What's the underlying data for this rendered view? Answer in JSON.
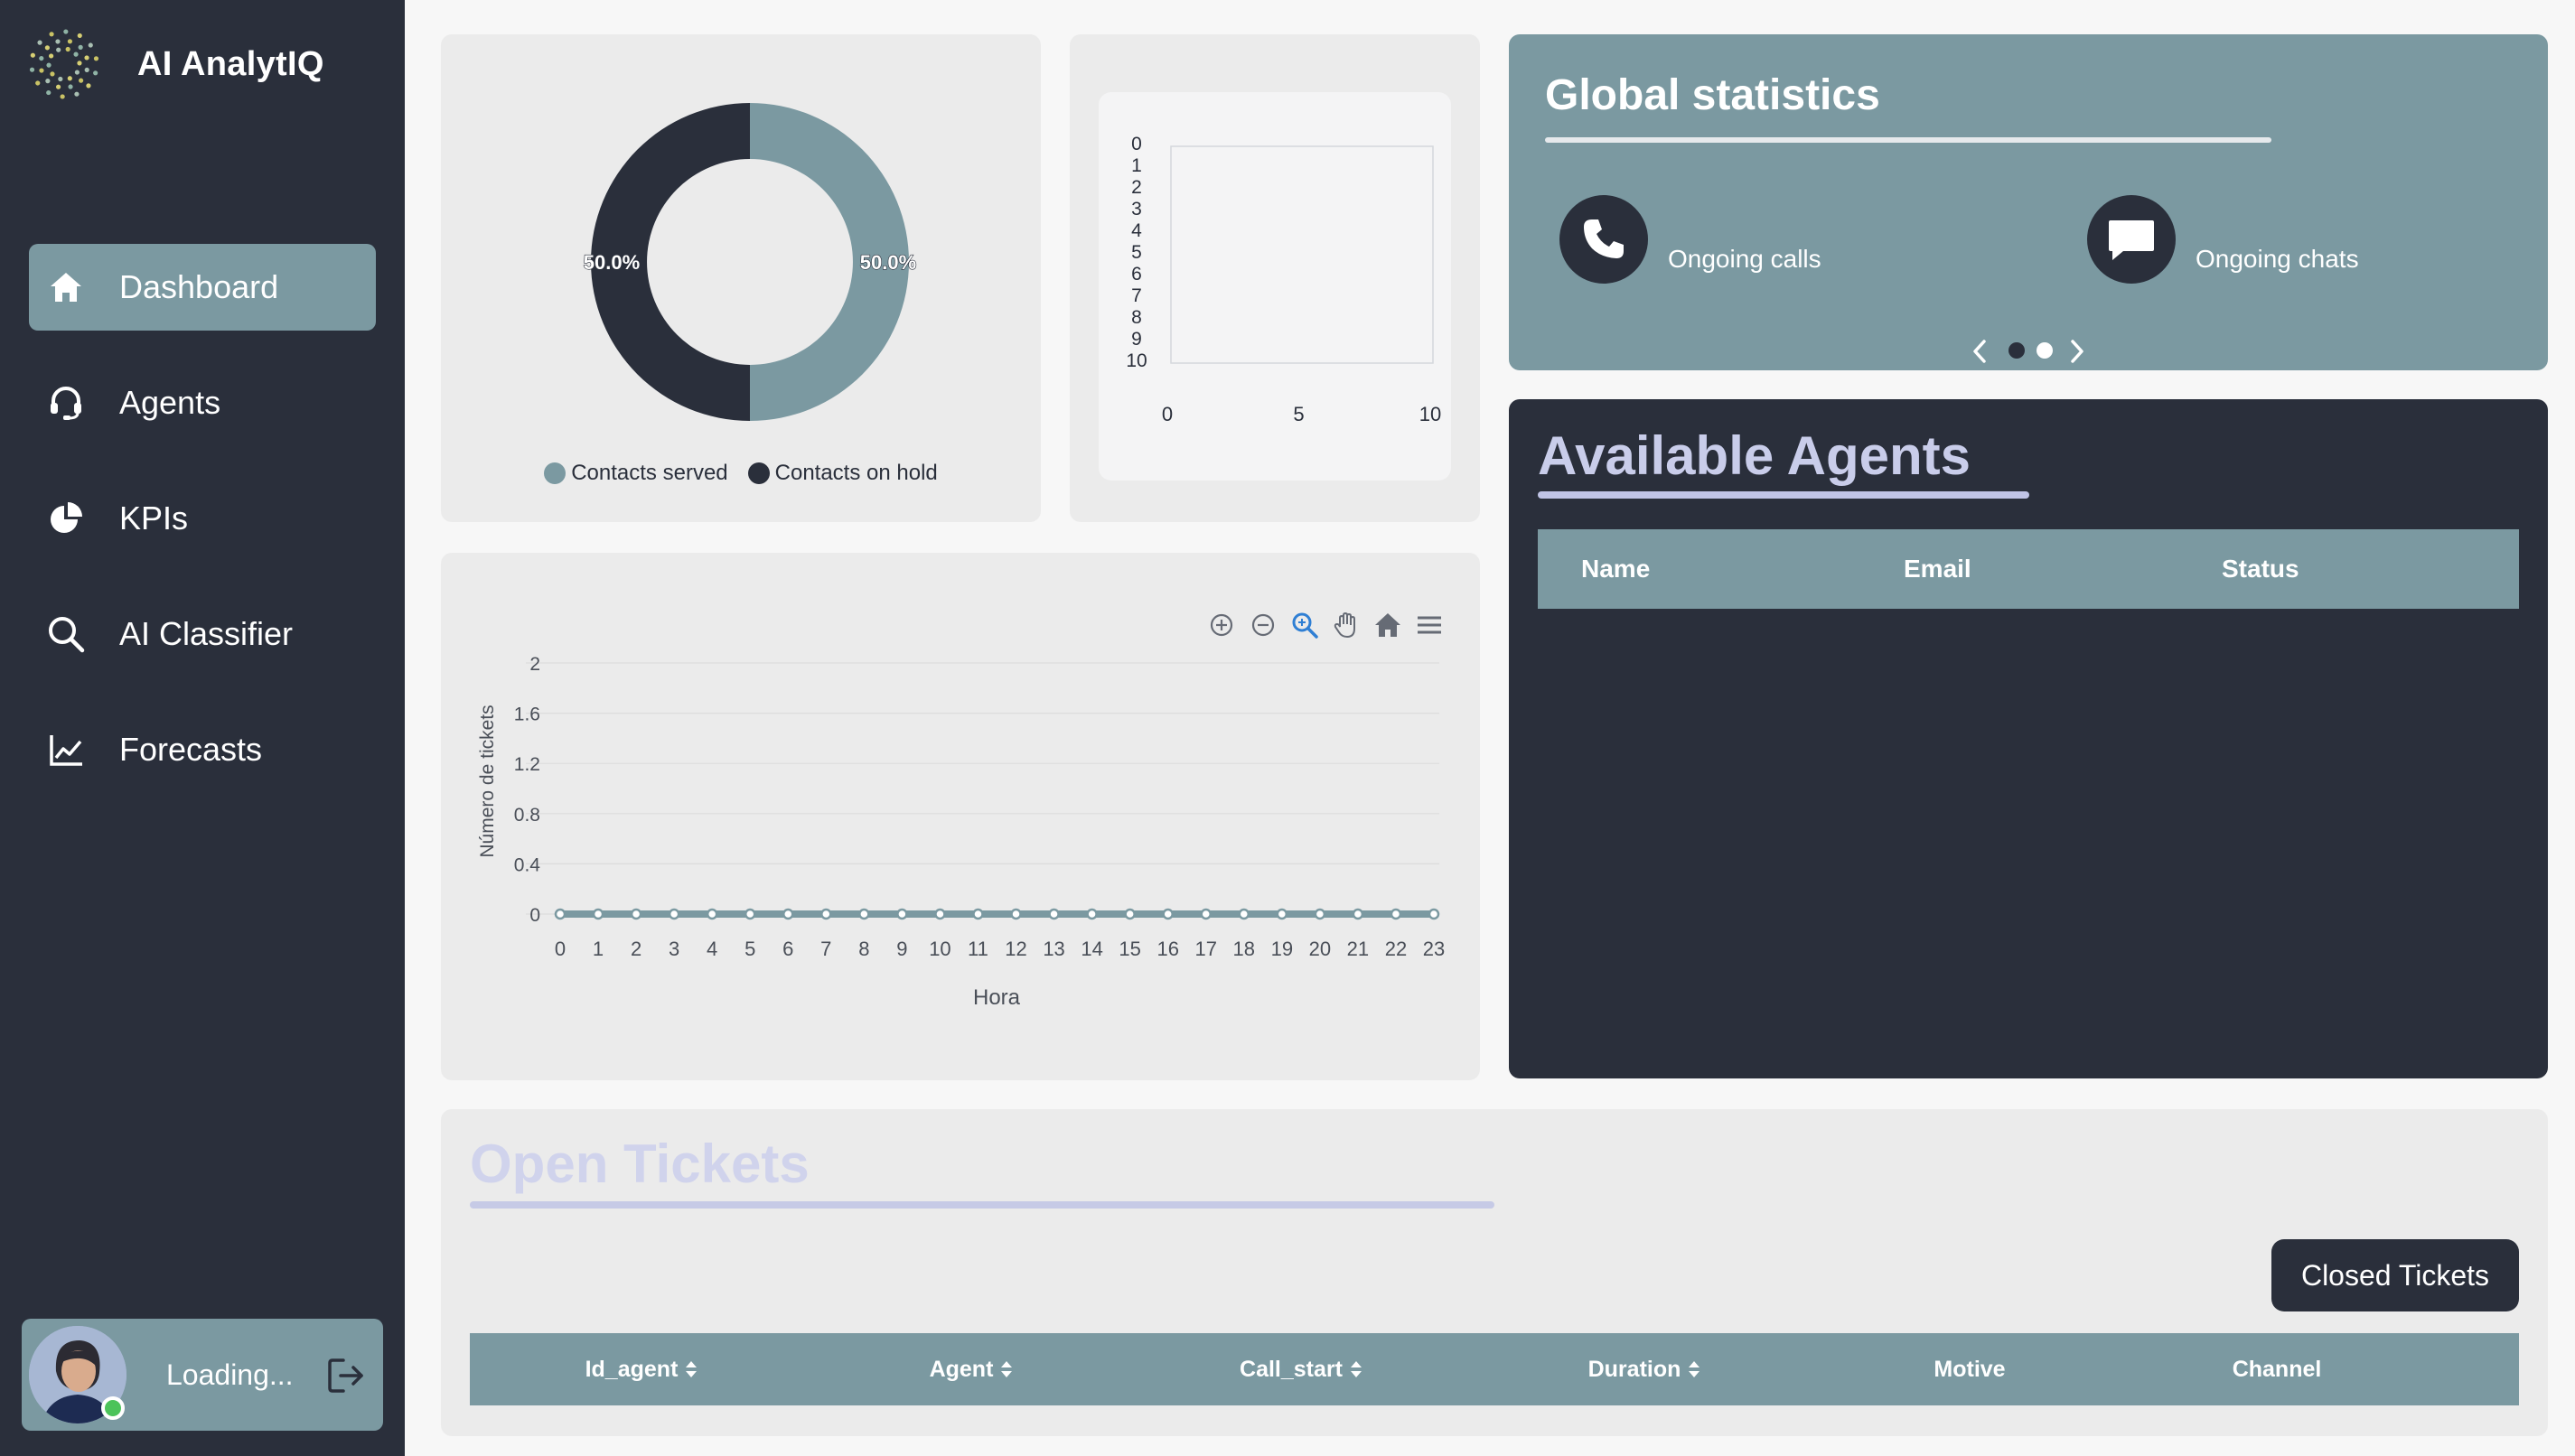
{
  "app": {
    "name": "AI AnalytIQ"
  },
  "sidebar": {
    "items": [
      {
        "label": "Dashboard",
        "icon": "home-icon",
        "active": true
      },
      {
        "label": "Agents",
        "icon": "headset-icon",
        "active": false
      },
      {
        "label": "KPIs",
        "icon": "pie-chart-icon",
        "active": false
      },
      {
        "label": "AI Classifier",
        "icon": "search-icon",
        "active": false
      },
      {
        "label": "Forecasts",
        "icon": "line-chart-icon",
        "active": false
      }
    ],
    "user": {
      "name": "Loading...",
      "status": "online"
    }
  },
  "colors": {
    "accent": "#7b99a1",
    "dark": "#2a2f3b",
    "online": "#4cc35a",
    "title_lavender": "#c9cdea"
  },
  "chart_data": [
    {
      "type": "pie",
      "donut": true,
      "series": [
        {
          "name": "Contacts served",
          "value": 50.0,
          "label": "50.0%",
          "color": "#7b99a1"
        },
        {
          "name": "Contacts on hold",
          "value": 50.0,
          "label": "50.0%",
          "color": "#2a2f3b"
        }
      ],
      "legend": "bottom"
    },
    {
      "type": "bar",
      "y_ticks": [
        "0",
        "1",
        "2",
        "3",
        "4",
        "5",
        "6",
        "7",
        "8",
        "9",
        "10"
      ],
      "x_ticks": [
        "0",
        "5",
        "10"
      ],
      "series": []
    },
    {
      "type": "area",
      "xlabel": "Hora",
      "ylabel": "Número de tickets",
      "x": [
        "0",
        "1",
        "2",
        "3",
        "4",
        "5",
        "6",
        "7",
        "8",
        "9",
        "10",
        "11",
        "12",
        "13",
        "14",
        "15",
        "16",
        "17",
        "18",
        "19",
        "20",
        "21",
        "22",
        "23"
      ],
      "y_ticks": [
        "0",
        "0.4",
        "0.8",
        "1.2",
        "1.6",
        "2"
      ],
      "ylim": [
        0,
        2
      ],
      "values": [
        0,
        0,
        0,
        0,
        0,
        0,
        0,
        0,
        0,
        0,
        0,
        0,
        0,
        0,
        0,
        0,
        0,
        0,
        0,
        0,
        0,
        0,
        0,
        0
      ],
      "grid": true
    }
  ],
  "global_stats": {
    "title": "Global statistics",
    "items": [
      {
        "label": "Ongoing calls",
        "icon": "phone-icon"
      },
      {
        "label": "Ongoing chats",
        "icon": "chat-icon"
      }
    ],
    "carousel_active": 0
  },
  "agents": {
    "title": "Available Agents",
    "columns": [
      "Name",
      "Email",
      "Status"
    ],
    "rows": []
  },
  "tickets": {
    "title": "Open Tickets",
    "closed_button": "Closed Tickets",
    "columns": [
      {
        "label": "Id_agent",
        "sortable": true
      },
      {
        "label": "Agent",
        "sortable": true
      },
      {
        "label": "Call_start",
        "sortable": true
      },
      {
        "label": "Duration",
        "sortable": true
      },
      {
        "label": "Motive",
        "sortable": false
      },
      {
        "label": "Channel",
        "sortable": false
      }
    ],
    "rows": []
  }
}
